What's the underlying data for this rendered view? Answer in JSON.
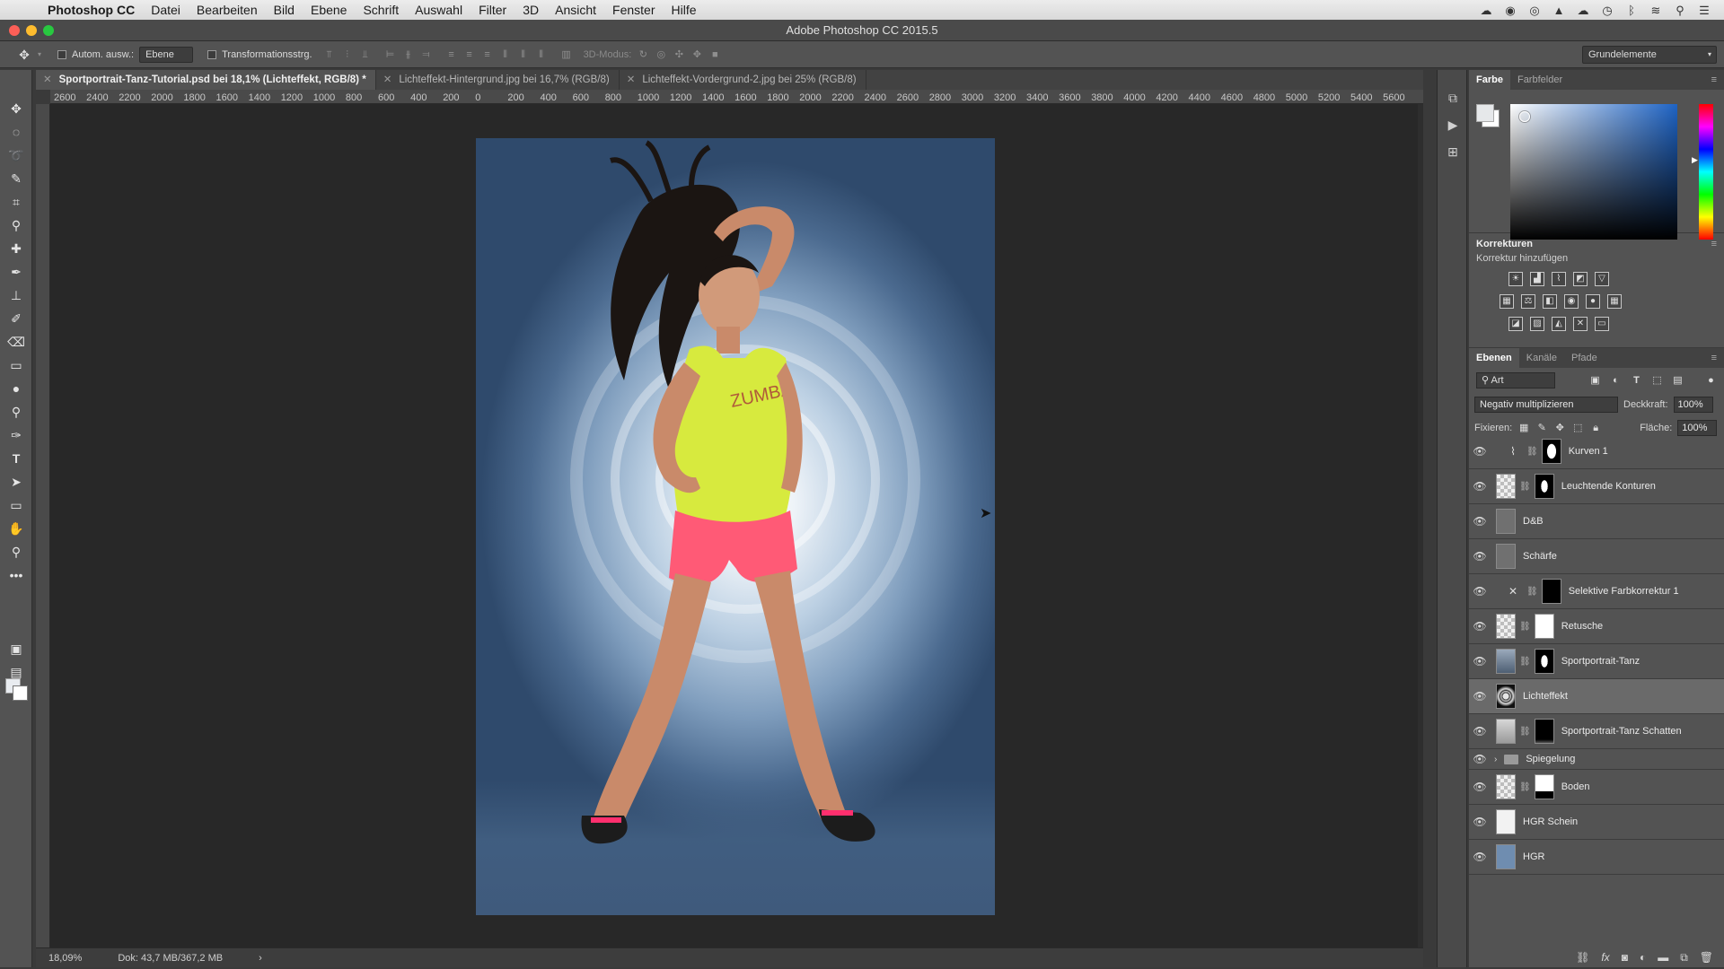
{
  "menubar": {
    "app_name": "Photoshop CC",
    "items": [
      "Datei",
      "Bearbeiten",
      "Bild",
      "Ebene",
      "Schrift",
      "Auswahl",
      "Filter",
      "3D",
      "Ansicht",
      "Fenster",
      "Hilfe"
    ]
  },
  "window": {
    "title": "Adobe Photoshop CC 2015.5"
  },
  "options_bar": {
    "auto_select_label": "Autom. ausw.:",
    "auto_select_value": "Ebene",
    "transform_label": "Transformationsstrg.",
    "mode3d_label": "3D-Modus:",
    "workspace": "Grundelemente"
  },
  "tabs": [
    {
      "label": "Sportportrait-Tanz-Tutorial.psd bei 18,1% (Lichteffekt, RGB/8) *",
      "active": true
    },
    {
      "label": "Lichteffekt-Hintergrund.jpg bei 16,7% (RGB/8)",
      "active": false
    },
    {
      "label": "Lichteffekt-Vordergrund-2.jpg bei 25% (RGB/8)",
      "active": false
    }
  ],
  "ruler_top": [
    "2600",
    "2400",
    "2200",
    "2000",
    "1800",
    "1600",
    "1400",
    "1200",
    "1000",
    "800",
    "600",
    "400",
    "200",
    "0",
    "200",
    "400",
    "600",
    "800",
    "1000",
    "1200",
    "1400",
    "1600",
    "1800",
    "2000",
    "2200",
    "2400",
    "2600",
    "2800",
    "3000",
    "3200",
    "3400",
    "3600",
    "3800",
    "4000",
    "4200",
    "4400",
    "4600",
    "4800",
    "5000",
    "5200",
    "5400",
    "5600"
  ],
  "status": {
    "zoom": "18,09%",
    "doc": "Dok: 43,7 MB/367,2 MB"
  },
  "color_panel": {
    "tabs": [
      "Farbe",
      "Farbfelder"
    ]
  },
  "corrections": {
    "title": "Korrekturen",
    "subtitle": "Korrektur hinzufügen"
  },
  "layers_panel": {
    "tabs": [
      "Ebenen",
      "Kanäle",
      "Pfade"
    ],
    "filter": "Art",
    "blend_mode": "Negativ multiplizieren",
    "opacity_label": "Deckkraft:",
    "opacity_value": "100%",
    "lock_label": "Fixieren:",
    "fill_label": "Fläche:",
    "fill_value": "100%",
    "layers": [
      "Kurven 1",
      "Leuchtende Konturen",
      "D&B",
      "Schärfe",
      "Selektive Farbkorrektur 1",
      "Retusche",
      "Sportportrait-Tanz",
      "Lichteffekt",
      "Sportportrait-Tanz Schatten",
      "Spiegelung",
      "Boden",
      "HGR Schein",
      "HGR"
    ]
  }
}
